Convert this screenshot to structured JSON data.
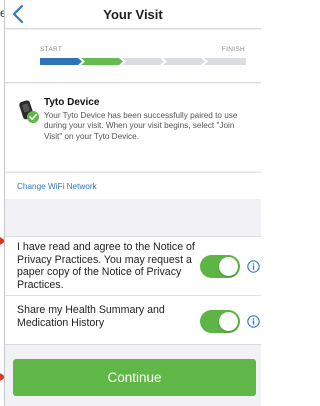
{
  "edge_glyph": "e",
  "nav": {
    "title": "Your Visit"
  },
  "progress": {
    "start_label": "START",
    "finish_label": "FINISH",
    "steps_total": 5,
    "steps_completed": 2,
    "colors": {
      "step_1": "#2e72b8",
      "step_2": "#67bb4f",
      "pending": "#d9dce0"
    }
  },
  "device": {
    "title": "Tyto Device",
    "description": "Your Tyto Device has been successfully paired to use during your visit. When your visit begins, select \"Join Visit\" on your Tyto Device.",
    "status": "connected"
  },
  "wifi": {
    "link_label": "Change WiFi Network"
  },
  "consent": {
    "privacy": {
      "text": "I have read and agree to the Notice of Privacy Practices. You may request a paper copy of the Notice of Privacy Practices.",
      "toggle_on": true
    },
    "share": {
      "text": "Share my Health Summary and Medication History",
      "toggle_on": true
    }
  },
  "continue_label": "Continue",
  "colors": {
    "accent_green": "#5fb747",
    "link_blue": "#2f7abf",
    "annotation_red": "#d9392b"
  }
}
